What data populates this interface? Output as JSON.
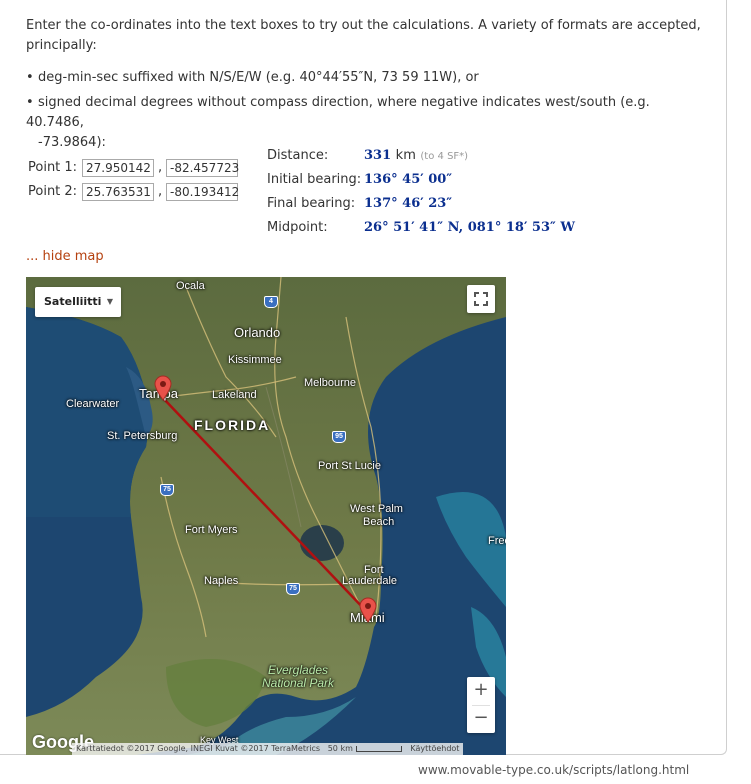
{
  "intro": "Enter the co-ordinates into the text boxes to try out the calculations. A variety of formats are accepted, principally:",
  "bullets": [
    "deg-min-sec suffixed with N/S/E/W (e.g. 40°44′55″N, 73 59 11W), or",
    "signed decimal degrees without compass direction, where negative indicates west/south (e.g. 40.7486,",
    "-73.9864):"
  ],
  "bullet_char": "•",
  "points": [
    {
      "label": "Point 1:",
      "lat": "27.950142",
      "lon": "-82.457723"
    },
    {
      "label": "Point 2:",
      "lat": "25.763531",
      "lon": "-80.193412"
    }
  ],
  "comma": ",",
  "results": {
    "distance_label": "Distance:",
    "distance_value": "331",
    "distance_unit": "km",
    "distance_note": "(to 4 SF*)",
    "initial_label": "Initial bearing:",
    "initial_value": "136° 45′ 00″",
    "final_label": "Final bearing:",
    "final_value": "137° 46′ 23″",
    "midpoint_label": "Midpoint:",
    "midpoint_value": "26° 51′ 41″ N, 081° 18′ 53″ W"
  },
  "hide_map_link": "... hide map",
  "map": {
    "type_selector": "Satelliitti",
    "labels": {
      "ocala": "Ocala",
      "orlando": "Orlando",
      "kissimmee": "Kissimmee",
      "melbourne": "Melbourne",
      "tampa": "Tampa",
      "clearwater": "Clearwater",
      "lakeland": "Lakeland",
      "florida": "FLORIDA",
      "st_petersburg": "St. Petersburg",
      "port_st_lucie": "Port St Lucie",
      "west_palm_beach_1": "West Palm",
      "west_palm_beach_2": "Beach",
      "fort_myers": "Fort Myers",
      "fort_lauderdale_1": "Fort",
      "fort_lauderdale_2": "Lauderdale",
      "naples": "Naples",
      "miami": "Miami",
      "everglades_1": "Everglades",
      "everglades_2": "National Park",
      "freeport": "Free",
      "key_west": "Key West"
    },
    "shields": [
      "4",
      "95",
      "75",
      "75"
    ],
    "zoom_in": "+",
    "zoom_out": "−",
    "google_logo": "Google",
    "attribution": "Karttatiedot ©2017 Google, INEGI Kuvat ©2017 TerraMetrics",
    "scale_label": "50 km",
    "terms": "Käyttöehdot",
    "colors": {
      "route": "#b01010",
      "pin": "#e8524a"
    }
  },
  "footer_url": "www.movable-type.co.uk/scripts/latlong.html"
}
